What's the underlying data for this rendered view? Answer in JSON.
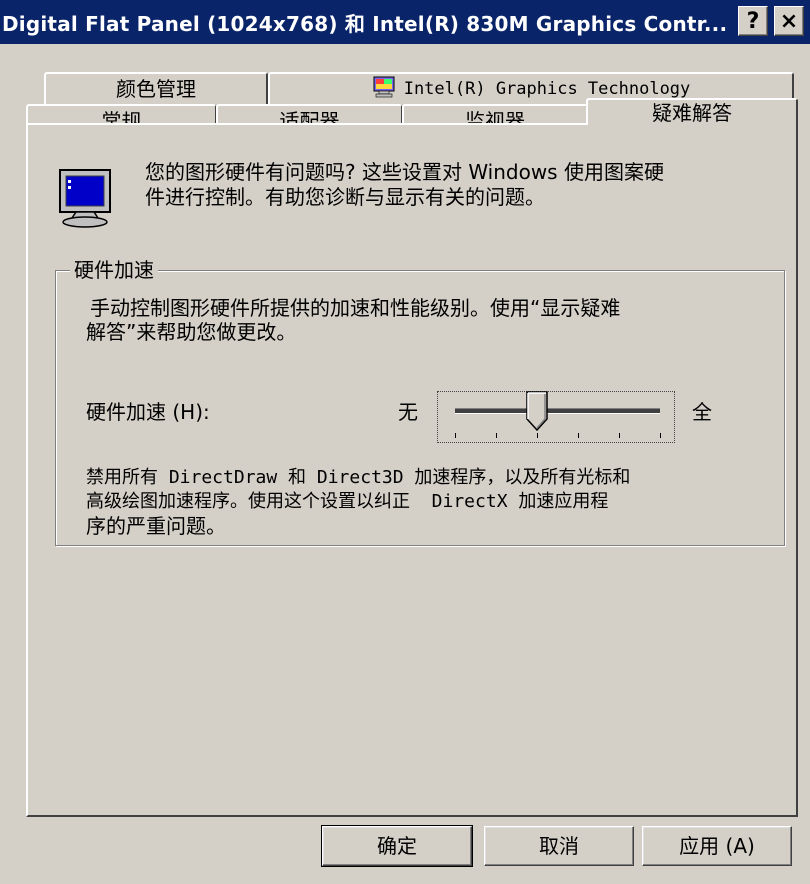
{
  "window": {
    "title": "Digital Flat Panel (1024x768) 和 Intel(R) 830M Graphics Contr...",
    "help_button": "?",
    "close_button": "×"
  },
  "tabs": {
    "row1": [
      {
        "label": "颜色管理"
      },
      {
        "label": "Intel(R) Graphics Technology",
        "icon": "intel-graphics-icon"
      }
    ],
    "row2": [
      {
        "label": "常规"
      },
      {
        "label": "适配器"
      },
      {
        "label": "监视器"
      },
      {
        "label": "疑难解答",
        "active": true
      }
    ]
  },
  "intro": {
    "icon": "monitor-icon",
    "line1": "您的图形硬件有问题吗? 这些设置对 Windows 使用图案硬",
    "line2": "件进行控制。有助您诊断与显示有关的问题。"
  },
  "hw_group": {
    "label": "硬件加速",
    "desc_line1": "手动控制图形硬件所提供的加速和性能级别。使用“显示疑难",
    "desc_line2": "解答”来帮助您做更改。",
    "slider_label": "硬件加速 (H):",
    "slider_min_label": "无",
    "slider_max_label": "全",
    "slider_level": 0.4,
    "slider_ticks": 6,
    "note_line1": "禁用所有 DirectDraw 和 Direct3D 加速程序，以及所有光标和",
    "note_line2": "高级绘图加速程序。使用这个设置以纠正  DirectX 加速应用程",
    "note_line3": "序的严重问题。"
  },
  "buttons": {
    "ok": "确定",
    "cancel": "取消",
    "apply": "应用 (A)"
  }
}
